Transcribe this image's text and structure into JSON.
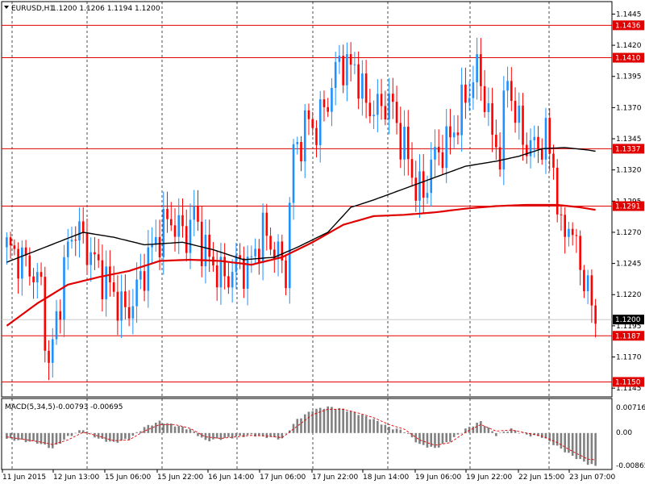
{
  "header": {
    "symbol": "EURUSD,H1",
    "ohlc": "1.1200 1.1206 1.1194 1.1200",
    "menu_icon": "triangle-down-icon"
  },
  "macd": {
    "label": "MACD(5,34,5)",
    "main_value": "-0.00793",
    "signal_value": "-0.00695",
    "ticks": [
      "0.00716",
      "0.00",
      "-0.00865"
    ]
  },
  "chart_data": {
    "type": "candlestick",
    "instrument": "EURUSD",
    "timeframe": "H1",
    "price_axis_labels": [
      "1.1445",
      "1.1420",
      "1.1395",
      "1.1370",
      "1.1345",
      "1.1320",
      "1.1295",
      "1.1270",
      "1.1245",
      "1.1220",
      "1.1195",
      "1.1170",
      "1.1145"
    ],
    "ylim": [
      1.1138,
      1.1455
    ],
    "grid": true,
    "time_labels": [
      "11 Jun 2015",
      "12 Jun 13:00",
      "15 Jun 06:00",
      "15 Jun 22:00",
      "16 Jun 14:00",
      "17 Jun 06:00",
      "17 Jun 22:00",
      "18 Jun 14:00",
      "19 Jun 06:00",
      "19 Jun 22:00",
      "22 Jun 15:00",
      "23 Jun 07:00"
    ],
    "horizontal_levels": [
      {
        "value": 1.1436,
        "label": "1.1436"
      },
      {
        "value": 1.141,
        "label": "1.1410"
      },
      {
        "value": 1.1337,
        "label": "1.1337"
      },
      {
        "value": 1.1291,
        "label": "1.1291"
      },
      {
        "value": 1.1187,
        "label": "1.1187"
      },
      {
        "value": 1.115,
        "label": "1.1150"
      }
    ],
    "current_price": {
      "value": 1.12,
      "label": "1.1200"
    },
    "colors": {
      "bull": "#1e90ff",
      "bear": "#ff0000",
      "level": "#e00000",
      "ma_fast": "#000000",
      "ma_slow": "#e00000",
      "macd_hist": "#808080",
      "macd_signal": "#e00000"
    },
    "close_path": [
      [
        0,
        1.1258
      ],
      [
        3,
        1.125
      ],
      [
        6,
        1.1242
      ],
      [
        9,
        1.1225
      ],
      [
        11,
        1.116
      ],
      [
        13,
        1.12
      ],
      [
        16,
        1.1258
      ],
      [
        18,
        1.1275
      ],
      [
        20,
        1.1262
      ],
      [
        22,
        1.1253
      ],
      [
        24,
        1.124
      ],
      [
        26,
        1.1232
      ],
      [
        29,
        1.1215
      ],
      [
        31,
        1.1205
      ],
      [
        33,
        1.1215
      ],
      [
        35,
        1.1232
      ],
      [
        37,
        1.125
      ],
      [
        39,
        1.1262
      ],
      [
        41,
        1.1275
      ],
      [
        43,
        1.128
      ],
      [
        45,
        1.1272
      ],
      [
        47,
        1.1268
      ],
      [
        49,
        1.1285
      ],
      [
        51,
        1.1262
      ],
      [
        53,
        1.1248
      ],
      [
        55,
        1.124
      ],
      [
        57,
        1.1232
      ],
      [
        59,
        1.124
      ],
      [
        61,
        1.1245
      ],
      [
        63,
        1.124
      ],
      [
        65,
        1.1255
      ],
      [
        67,
        1.127
      ],
      [
        69,
        1.1262
      ],
      [
        71,
        1.125
      ],
      [
        73,
        1.124
      ],
      [
        75,
        1.1335
      ],
      [
        77,
        1.1345
      ],
      [
        79,
        1.136
      ],
      [
        81,
        1.1352
      ],
      [
        83,
        1.137
      ],
      [
        85,
        1.1385
      ],
      [
        87,
        1.141
      ],
      [
        89,
        1.14
      ],
      [
        91,
        1.1405
      ],
      [
        93,
        1.138
      ],
      [
        95,
        1.137
      ],
      [
        97,
        1.1368
      ],
      [
        99,
        1.1375
      ],
      [
        101,
        1.137
      ],
      [
        103,
        1.1345
      ],
      [
        105,
        1.133
      ],
      [
        107,
        1.1305
      ],
      [
        109,
        1.13
      ],
      [
        111,
        1.1325
      ],
      [
        113,
        1.1335
      ],
      [
        115,
        1.134
      ],
      [
        117,
        1.1352
      ],
      [
        119,
        1.137
      ],
      [
        121,
        1.1385
      ],
      [
        123,
        1.14
      ],
      [
        125,
        1.138
      ],
      [
        127,
        1.1345
      ],
      [
        129,
        1.1335
      ],
      [
        131,
        1.1395
      ],
      [
        133,
        1.1365
      ],
      [
        135,
        1.1345
      ],
      [
        137,
        1.1338
      ],
      [
        139,
        1.134
      ],
      [
        141,
        1.1345
      ],
      [
        143,
        1.1325
      ],
      [
        145,
        1.1265
      ],
      [
        147,
        1.128
      ],
      [
        149,
        1.1255
      ],
      [
        151,
        1.1235
      ],
      [
        153,
        1.121
      ],
      [
        154,
        1.12
      ]
    ],
    "ma_fast": [
      [
        0,
        1.1246
      ],
      [
        10,
        1.1258
      ],
      [
        20,
        1.127
      ],
      [
        28,
        1.1266
      ],
      [
        36,
        1.126
      ],
      [
        46,
        1.1262
      ],
      [
        54,
        1.1256
      ],
      [
        62,
        1.1248
      ],
      [
        70,
        1.125
      ],
      [
        76,
        1.1258
      ],
      [
        84,
        1.127
      ],
      [
        90,
        1.129
      ],
      [
        96,
        1.1296
      ],
      [
        104,
        1.1305
      ],
      [
        112,
        1.1314
      ],
      [
        120,
        1.1323
      ],
      [
        128,
        1.1327
      ],
      [
        134,
        1.1331
      ],
      [
        140,
        1.1337
      ],
      [
        146,
        1.1338
      ],
      [
        152,
        1.1336
      ],
      [
        154,
        1.1335
      ]
    ],
    "ma_slow": [
      [
        0,
        1.1195
      ],
      [
        8,
        1.1213
      ],
      [
        16,
        1.1228
      ],
      [
        24,
        1.1234
      ],
      [
        32,
        1.1239
      ],
      [
        40,
        1.1247
      ],
      [
        48,
        1.1248
      ],
      [
        56,
        1.1247
      ],
      [
        64,
        1.1244
      ],
      [
        72,
        1.125
      ],
      [
        80,
        1.1262
      ],
      [
        88,
        1.1276
      ],
      [
        96,
        1.1283
      ],
      [
        104,
        1.1284
      ],
      [
        112,
        1.1286
      ],
      [
        120,
        1.1289
      ],
      [
        128,
        1.1291
      ],
      [
        136,
        1.1292
      ],
      [
        144,
        1.1292
      ],
      [
        150,
        1.129
      ],
      [
        154,
        1.1288
      ]
    ],
    "macd_hist": [
      [
        0,
        -0.0015
      ],
      [
        8,
        -0.0025
      ],
      [
        12,
        -0.004
      ],
      [
        16,
        -0.001
      ],
      [
        20,
        0.001
      ],
      [
        24,
        -0.0015
      ],
      [
        28,
        -0.0025
      ],
      [
        32,
        -0.0015
      ],
      [
        36,
        0.0015
      ],
      [
        40,
        0.003
      ],
      [
        44,
        0.002
      ],
      [
        48,
        0.001
      ],
      [
        52,
        -0.002
      ],
      [
        56,
        -0.0015
      ],
      [
        60,
        -0.001
      ],
      [
        64,
        -0.0005
      ],
      [
        68,
        -0.001
      ],
      [
        72,
        -0.0015
      ],
      [
        76,
        0.0035
      ],
      [
        80,
        0.006
      ],
      [
        84,
        0.0068
      ],
      [
        88,
        0.0062
      ],
      [
        92,
        0.005
      ],
      [
        96,
        0.0035
      ],
      [
        100,
        0.0015
      ],
      [
        104,
        0.0005
      ],
      [
        108,
        -0.003
      ],
      [
        112,
        -0.004
      ],
      [
        116,
        -0.002
      ],
      [
        120,
        0.001
      ],
      [
        124,
        0.003
      ],
      [
        128,
        -0.0005
      ],
      [
        132,
        0.001
      ],
      [
        136,
        -0.0005
      ],
      [
        140,
        -0.001
      ],
      [
        144,
        -0.0035
      ],
      [
        148,
        -0.006
      ],
      [
        152,
        -0.008
      ],
      [
        154,
        -0.0086
      ]
    ],
    "macd_signal": [
      [
        0,
        -0.001
      ],
      [
        8,
        -0.0022
      ],
      [
        12,
        -0.003
      ],
      [
        16,
        -0.0018
      ],
      [
        20,
        0.0002
      ],
      [
        24,
        -0.0008
      ],
      [
        28,
        -0.002
      ],
      [
        32,
        -0.0018
      ],
      [
        36,
        0.0005
      ],
      [
        40,
        0.0022
      ],
      [
        44,
        0.0022
      ],
      [
        48,
        0.0012
      ],
      [
        52,
        -0.001
      ],
      [
        56,
        -0.0014
      ],
      [
        60,
        -0.001
      ],
      [
        64,
        -0.0006
      ],
      [
        68,
        -0.0008
      ],
      [
        72,
        -0.0012
      ],
      [
        76,
        0.0018
      ],
      [
        80,
        0.0048
      ],
      [
        84,
        0.0062
      ],
      [
        88,
        0.0062
      ],
      [
        92,
        0.0052
      ],
      [
        96,
        0.004
      ],
      [
        100,
        0.0022
      ],
      [
        104,
        0.001
      ],
      [
        108,
        -0.0018
      ],
      [
        112,
        -0.0032
      ],
      [
        116,
        -0.0025
      ],
      [
        120,
        0.0002
      ],
      [
        124,
        0.0022
      ],
      [
        128,
        0.0005
      ],
      [
        132,
        0.0008
      ],
      [
        136,
        0.0
      ],
      [
        140,
        -0.0008
      ],
      [
        144,
        -0.0025
      ],
      [
        148,
        -0.0048
      ],
      [
        152,
        -0.0068
      ],
      [
        154,
        -0.007
      ]
    ]
  }
}
